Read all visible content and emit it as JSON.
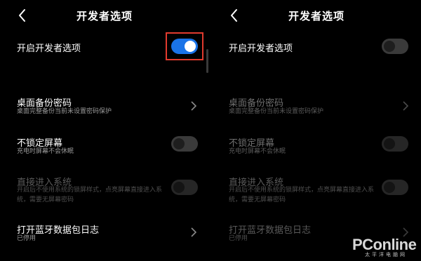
{
  "left": {
    "title": "开发者选项",
    "dev_options_label": "开启开发者选项",
    "dev_options_toggle": "on",
    "items": [
      {
        "label": "桌面备份密码",
        "sub": "桌面完整备份当前未设置密码保护"
      },
      {
        "label": "不锁定屏幕",
        "sub": "充电时屏幕不会休眠",
        "toggle": "off"
      },
      {
        "label": "直接进入系统",
        "sub": "开启后不使用系统的锁屏样式，点亮屏幕直接进入系统，需要无屏幕密码",
        "toggle": "off"
      },
      {
        "label": "打开蓝牙数据包日志",
        "sub": "已停用"
      }
    ]
  },
  "right": {
    "title": "开发者选项",
    "dev_options_label": "开启开发者选项",
    "dev_options_toggle": "off",
    "items": [
      {
        "label": "桌面备份密码",
        "sub": "桌面完整备份当前未设置密码保护"
      },
      {
        "label": "不锁定屏幕",
        "sub": "充电时屏幕不会休眠",
        "toggle": "off"
      },
      {
        "label": "直接进入系统",
        "sub": "开启后不使用系统的锁屏样式，点亮屏幕直接进入系统，需要无屏幕密码",
        "toggle": "off"
      },
      {
        "label": "打开蓝牙数据包日志",
        "sub": "已停用"
      }
    ]
  },
  "watermark": {
    "brand": "PConline",
    "sub": "太平洋电脑网"
  },
  "colors": {
    "accent": "#1a73e8",
    "highlight": "#e23b2e",
    "background": "#000000"
  }
}
